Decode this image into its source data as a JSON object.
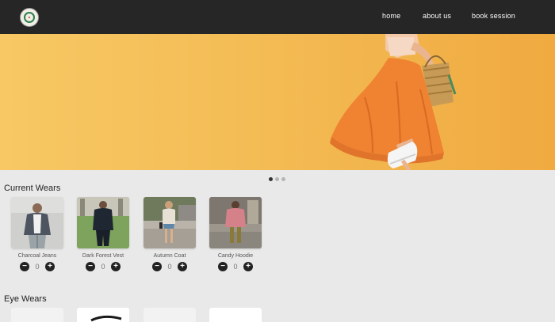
{
  "nav": {
    "logo_icon": "brand-logo-icon",
    "links": [
      "home",
      "about us",
      "book session"
    ]
  },
  "carousel": {
    "slide_count": 3,
    "active_index": 0
  },
  "sections": {
    "current_wears": {
      "title": "Current Wears",
      "items": [
        {
          "name": "Charcoal Jeans",
          "qty": "0"
        },
        {
          "name": "Dark Forest Vest",
          "qty": "0"
        },
        {
          "name": "Autumn Coat",
          "qty": "0"
        },
        {
          "name": "Candy Hoodie",
          "qty": "0"
        }
      ]
    },
    "eye_wears": {
      "title": "Eye Wears"
    }
  },
  "controls": {
    "minus_icon": "minus-circle-icon",
    "plus_icon": "plus-circle-icon",
    "minus_glyph": "−",
    "plus_glyph": "+"
  },
  "colors": {
    "navbar": "#262626",
    "hero_background": "#f4bc55",
    "page_background": "#e9e9e9"
  }
}
